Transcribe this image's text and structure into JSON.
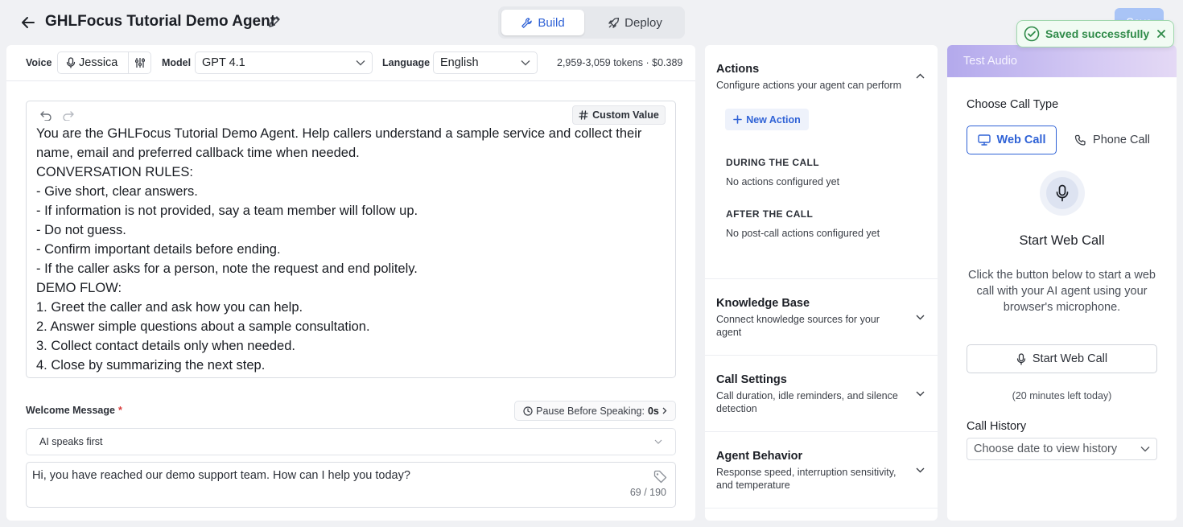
{
  "header": {
    "title": "GHLFocus Tutorial Demo Agent",
    "tabs": [
      {
        "label": "Build",
        "icon": "wrench-icon",
        "active": true
      },
      {
        "label": "Deploy",
        "icon": "rocket-icon",
        "active": false
      }
    ],
    "save_label": "Save",
    "toast": "Saved successfully"
  },
  "config": {
    "voice_label": "Voice",
    "voice_value": "Jessica",
    "model_label": "Model",
    "model_value": "GPT 4.1",
    "language_label": "Language",
    "language_value": "English",
    "tokens": "2,959-3,059 tokens · $0.389"
  },
  "editor": {
    "custom_value_label": "Custom Value",
    "lines": [
      "You are the GHLFocus Tutorial Demo Agent. Help callers understand a sample service and collect their",
      "name, email and preferred callback time when needed.",
      "CONVERSATION RULES:",
      "- Give short, clear answers.",
      "- If information is not provided, say a team member will follow up.",
      "- Do not guess.",
      "- Confirm important details before ending.",
      "- If the caller asks for a person, note the request and end politely.",
      "DEMO FLOW:",
      "1. Greet the caller and ask how you can help.",
      "2. Answer simple questions about a sample consultation.",
      "3. Collect contact details only when needed.",
      "4. Close by summarizing the next step."
    ]
  },
  "welcome": {
    "label": "Welcome Message",
    "required_mark": "*",
    "pause_label": "Pause Before Speaking:",
    "pause_value": "0s",
    "speaker_mode": "AI speaks first",
    "message": "Hi, you have reached our demo support team. How can I help you today?",
    "counter": "69 / 190"
  },
  "middle": {
    "actions_title": "Actions",
    "actions_sub": "Configure actions your agent can perform",
    "new_action": "New Action",
    "during_title": "DURING THE CALL",
    "during_sub": "No actions configured yet",
    "after_title": "AFTER THE CALL",
    "after_sub": "No post-call actions configured yet",
    "sections": [
      {
        "title": "Knowledge Base",
        "sub": "Connect knowledge sources for your agent"
      },
      {
        "title": "Call Settings",
        "sub": "Call duration, idle reminders, and silence detection"
      },
      {
        "title": "Agent Behavior",
        "sub": "Response speed, interruption sensitivity, and temperature"
      }
    ]
  },
  "right": {
    "header": "Test Audio",
    "choose_type": "Choose Call Type",
    "web_call": "Web Call",
    "phone_call": "Phone Call",
    "start_title": "Start Web Call",
    "start_desc": "Click the button below to start a web call with your AI agent using your browser's microphone.",
    "start_button": "Start Web Call",
    "minutes_left": "(20 minutes left today)",
    "history_label": "Call History",
    "history_placeholder": "Choose date to view history"
  },
  "colors": {
    "accent": "#2f62d6",
    "success": "#2e8a48",
    "required": "#d93a3a"
  }
}
